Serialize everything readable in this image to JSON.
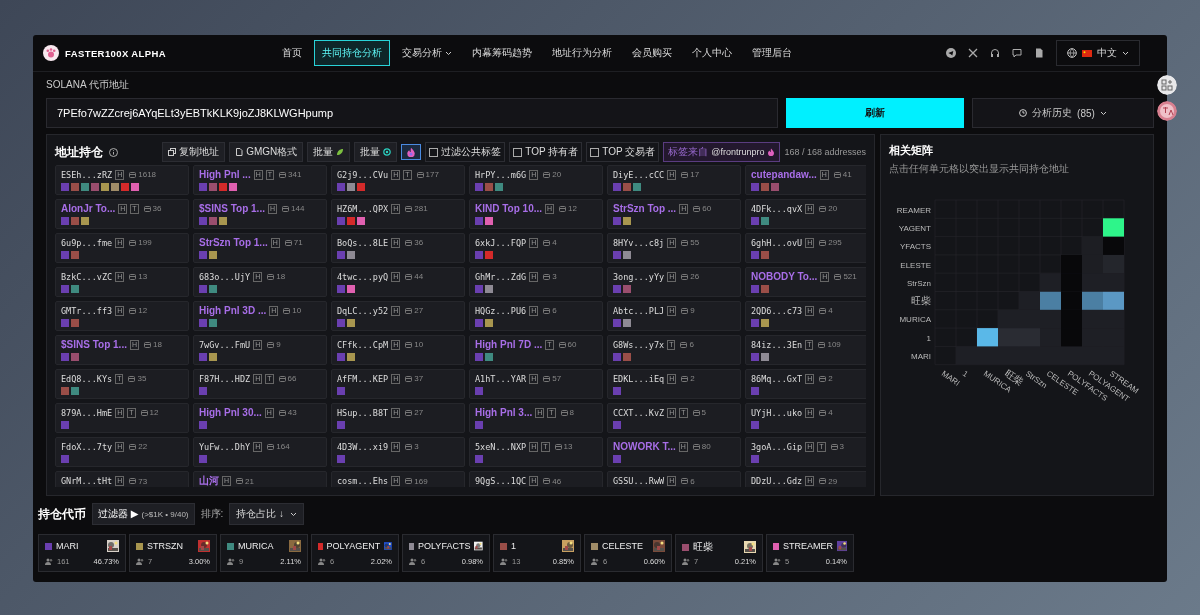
{
  "brand": "FASTER100X ALPHA",
  "nav": [
    {
      "label": "首页",
      "selected": false,
      "has_menu": false
    },
    {
      "label": "共同持仓分析",
      "selected": true,
      "has_menu": false
    },
    {
      "label": "交易分析",
      "selected": false,
      "has_menu": true
    },
    {
      "label": "内幕筹码趋势",
      "selected": false,
      "has_menu": false
    },
    {
      "label": "地址行为分析",
      "selected": false,
      "has_menu": false
    },
    {
      "label": "会员购买",
      "selected": false,
      "has_menu": false
    },
    {
      "label": "个人中心",
      "selected": false,
      "has_menu": false
    },
    {
      "label": "管理后台",
      "selected": false,
      "has_menu": false
    }
  ],
  "language": "中文",
  "token_address": {
    "label": "SOLANA 代币地址",
    "value": "7PEfo7wZZcrej6AYqELt3yEBTkKLK9joZJ8KLWGHpump"
  },
  "refresh_button": "刷新",
  "history": {
    "label": "分析历史",
    "count": "(85)"
  },
  "holdings": {
    "title": "地址持仓",
    "tools": [
      "复制地址",
      "GMGN格式",
      "批量",
      "批量"
    ],
    "icon_toggle": {
      "on": true
    },
    "filters": [
      {
        "label": "过滤公共标签",
        "checked": false
      },
      {
        "label": "TOP 持有者",
        "checked": false
      },
      {
        "label": "TOP 交易者",
        "checked": false
      }
    ],
    "source_badge": {
      "prefix": "标签来自",
      "handle": "@frontrunpro"
    },
    "total": "168 / 168 addresses",
    "cards": [
      {
        "kind": "address",
        "name": "ESEh...zRZ",
        "tags": [
          "H"
        ],
        "count": "1618",
        "chips": [
          {
            "color": "#6a3fb0"
          },
          {
            "color": "#9a4e48"
          },
          {
            "color": "#3f8a80"
          },
          {
            "color": "#9a4e6e"
          },
          {
            "color": "#a8964f"
          },
          {
            "color": "#a08c68"
          },
          {
            "color": "#d42a2a"
          },
          {
            "color": "#e060b0"
          }
        ]
      },
      {
        "kind": "label",
        "name": "High Pnl ...",
        "tags": [
          "H",
          "T"
        ],
        "count": "341",
        "chips": [
          {
            "color": "#6a3fb0"
          },
          {
            "color": "#9a4e6e"
          },
          {
            "color": "#d42a2a"
          },
          {
            "color": "#e060b0"
          }
        ]
      },
      {
        "kind": "address",
        "name": "G2j9...CVu",
        "tags": [
          "H",
          "T"
        ],
        "count": "177",
        "chips": [
          {
            "color": "#6a3fb0"
          },
          {
            "color": "#8e8a94"
          },
          {
            "color": "#d42a2a"
          }
        ]
      },
      {
        "kind": "address",
        "name": "HrPY...m6G",
        "tags": [
          "H"
        ],
        "count": "20",
        "chips": [
          {
            "color": "#6a3fb0"
          },
          {
            "color": "#9a4e48"
          },
          {
            "color": "#3f8a80"
          }
        ]
      },
      {
        "kind": "address",
        "name": "DiyE...cCC",
        "tags": [
          "H"
        ],
        "count": "17",
        "chips": [
          {
            "color": "#6a3fb0"
          },
          {
            "color": "#9a4e48"
          },
          {
            "color": "#3f8a80"
          }
        ]
      },
      {
        "kind": "label",
        "name": "cutepandaw...",
        "tags": [
          "H"
        ],
        "count": "41",
        "chips": [
          {
            "color": "#6a3fb0"
          },
          {
            "color": "#9a4e48"
          },
          {
            "color": "#9a4e6e"
          }
        ]
      },
      {
        "kind": "label",
        "name": "AlonJr To...",
        "tags": [
          "H",
          "T"
        ],
        "count": "36",
        "chips": [
          {
            "color": "#6a3fb0"
          },
          {
            "color": "#9a4e48"
          },
          {
            "color": "#a8964f"
          }
        ]
      },
      {
        "kind": "label",
        "name": "$SINS Top 1...",
        "tags": [
          "H"
        ],
        "count": "144",
        "chips": [
          {
            "color": "#6a3fb0"
          },
          {
            "color": "#9a4e6e"
          },
          {
            "color": "#a8964f"
          }
        ]
      },
      {
        "kind": "address",
        "name": "HZ6M...QPX",
        "tags": [
          "H"
        ],
        "count": "281",
        "chips": [
          {
            "color": "#6a3fb0"
          },
          {
            "color": "#d42a2a"
          },
          {
            "color": "#e060b0"
          }
        ]
      },
      {
        "kind": "label",
        "name": "KIND Top 10...",
        "tags": [
          "H"
        ],
        "count": "12",
        "chips": [
          {
            "color": "#6a3fb0"
          },
          {
            "color": "#e060b0"
          }
        ]
      },
      {
        "kind": "label",
        "name": "StrSzn Top ...",
        "tags": [
          "H"
        ],
        "count": "60",
        "chips": [
          {
            "color": "#6a3fb0"
          },
          {
            "color": "#a8964f"
          }
        ]
      },
      {
        "kind": "address",
        "name": "4DFk...qvX",
        "tags": [
          "H"
        ],
        "count": "20",
        "chips": [
          {
            "color": "#6a3fb0"
          },
          {
            "color": "#3f8a80"
          }
        ]
      },
      {
        "kind": "address",
        "name": "6u9p...fme",
        "tags": [
          "H"
        ],
        "count": "199",
        "chips": [
          {
            "color": "#6a3fb0"
          },
          {
            "color": "#9a4e48"
          }
        ]
      },
      {
        "kind": "label",
        "name": "StrSzn Top 1...",
        "tags": [
          "H"
        ],
        "count": "71",
        "chips": [
          {
            "color": "#6a3fb0"
          },
          {
            "color": "#a8964f"
          }
        ]
      },
      {
        "kind": "address",
        "name": "BoQs...8LE",
        "tags": [
          "H"
        ],
        "count": "36",
        "chips": [
          {
            "color": "#6a3fb0"
          },
          {
            "color": "#8e8a94"
          }
        ]
      },
      {
        "kind": "address",
        "name": "6xkJ...FQP",
        "tags": [
          "H"
        ],
        "count": "4",
        "chips": [
          {
            "color": "#6a3fb0"
          },
          {
            "color": "#d42a2a"
          }
        ]
      },
      {
        "kind": "address",
        "name": "8HYv...c8j",
        "tags": [
          "H"
        ],
        "count": "55",
        "chips": [
          {
            "color": "#6a3fb0"
          },
          {
            "color": "#8e8a94"
          }
        ]
      },
      {
        "kind": "address",
        "name": "6ghH...ovU",
        "tags": [
          "H"
        ],
        "count": "295",
        "chips": [
          {
            "color": "#6a3fb0"
          },
          {
            "color": "#9a4e48"
          }
        ]
      },
      {
        "kind": "address",
        "name": "BzkC...vZC",
        "tags": [
          "H"
        ],
        "count": "13",
        "chips": [
          {
            "color": "#6a3fb0"
          },
          {
            "color": "#3f8a80"
          }
        ]
      },
      {
        "kind": "address",
        "name": "683o...UjY",
        "tags": [
          "H"
        ],
        "count": "18",
        "chips": [
          {
            "color": "#6a3fb0"
          },
          {
            "color": "#3f8a80"
          }
        ]
      },
      {
        "kind": "address",
        "name": "4twc...pyQ",
        "tags": [
          "H"
        ],
        "count": "44",
        "chips": [
          {
            "color": "#6a3fb0"
          },
          {
            "color": "#e060b0"
          }
        ]
      },
      {
        "kind": "address",
        "name": "GhMr...ZdG",
        "tags": [
          "H"
        ],
        "count": "3",
        "chips": [
          {
            "color": "#6a3fb0"
          },
          {
            "color": "#8e8a94"
          }
        ]
      },
      {
        "kind": "address",
        "name": "3ong...yYy",
        "tags": [
          "H"
        ],
        "count": "26",
        "chips": [
          {
            "color": "#6a3fb0"
          },
          {
            "color": "#9a4e6e"
          }
        ]
      },
      {
        "kind": "label",
        "name": "NOBODY To...",
        "tags": [
          "H"
        ],
        "count": "521",
        "chips": [
          {
            "color": "#6a3fb0"
          },
          {
            "color": "#9a4e48"
          }
        ]
      },
      {
        "kind": "address",
        "name": "GMTr...ff3",
        "tags": [
          "H"
        ],
        "count": "12",
        "chips": [
          {
            "color": "#6a3fb0"
          },
          {
            "color": "#9a4e48"
          }
        ]
      },
      {
        "kind": "label",
        "name": "High Pnl 3D ...",
        "tags": [
          "H"
        ],
        "count": "10",
        "chips": [
          {
            "color": "#6a3fb0"
          },
          {
            "color": "#3f8a80"
          }
        ]
      },
      {
        "kind": "address",
        "name": "DqLC...y52",
        "tags": [
          "H"
        ],
        "count": "27",
        "chips": [
          {
            "color": "#6a3fb0"
          },
          {
            "color": "#a8964f"
          }
        ]
      },
      {
        "kind": "address",
        "name": "HQGz...PU6",
        "tags": [
          "H"
        ],
        "count": "6",
        "chips": [
          {
            "color": "#6a3fb0"
          },
          {
            "color": "#a8964f"
          }
        ]
      },
      {
        "kind": "address",
        "name": "Abtc...PLJ",
        "tags": [
          "H"
        ],
        "count": "9",
        "chips": [
          {
            "color": "#6a3fb0"
          },
          {
            "color": "#8e8a94"
          }
        ]
      },
      {
        "kind": "address",
        "name": "2QD6...c73",
        "tags": [
          "H"
        ],
        "count": "4",
        "chips": [
          {
            "color": "#6a3fb0"
          },
          {
            "color": "#a8964f"
          }
        ]
      },
      {
        "kind": "label",
        "name": "$SINS Top 1...",
        "tags": [
          "H"
        ],
        "count": "18",
        "chips": [
          {
            "color": "#6a3fb0"
          },
          {
            "color": "#9a4e6e"
          }
        ]
      },
      {
        "kind": "address",
        "name": "7wGv...FmU",
        "tags": [
          "H"
        ],
        "count": "9",
        "chips": [
          {
            "color": "#6a3fb0"
          },
          {
            "color": "#a8964f"
          }
        ]
      },
      {
        "kind": "address",
        "name": "CFfk...CpM",
        "tags": [
          "H"
        ],
        "count": "10",
        "chips": [
          {
            "color": "#6a3fb0"
          },
          {
            "color": "#a8964f"
          }
        ]
      },
      {
        "kind": "label",
        "name": "High Pnl 7D ...",
        "tags": [
          "T"
        ],
        "count": "60",
        "chips": [
          {
            "color": "#6a3fb0"
          },
          {
            "color": "#3f8a80"
          }
        ]
      },
      {
        "kind": "address",
        "name": "G8Ws...y7x",
        "tags": [
          "T"
        ],
        "count": "6",
        "chips": [
          {
            "color": "#6a3fb0"
          },
          {
            "color": "#9a4e48"
          }
        ]
      },
      {
        "kind": "address",
        "name": "84iz...3En",
        "tags": [
          "T"
        ],
        "count": "109",
        "chips": [
          {
            "color": "#6a3fb0"
          },
          {
            "color": "#8e8a94"
          }
        ]
      },
      {
        "kind": "address",
        "name": "EdQ8...KYs",
        "tags": [
          "T"
        ],
        "count": "35",
        "chips": [
          {
            "color": "#9a4e48"
          },
          {
            "color": "#3f8a80"
          }
        ]
      },
      {
        "kind": "address",
        "name": "F87H...HDZ",
        "tags": [
          "H",
          "T"
        ],
        "count": "66",
        "chips": [
          {
            "color": "#6a3fb0"
          }
        ]
      },
      {
        "kind": "address",
        "name": "AfFM...KEP",
        "tags": [
          "H"
        ],
        "count": "37",
        "chips": [
          {
            "color": "#6a3fb0"
          }
        ]
      },
      {
        "kind": "address",
        "name": "A1hT...YAR",
        "tags": [
          "H"
        ],
        "count": "57",
        "chips": [
          {
            "color": "#6a3fb0"
          }
        ]
      },
      {
        "kind": "address",
        "name": "EDKL...iEq",
        "tags": [
          "H"
        ],
        "count": "2",
        "chips": [
          {
            "color": "#6a3fb0"
          }
        ]
      },
      {
        "kind": "address",
        "name": "86Mq...GxT",
        "tags": [
          "H"
        ],
        "count": "2",
        "chips": [
          {
            "color": "#6a3fb0"
          }
        ]
      },
      {
        "kind": "address",
        "name": "879A...HmE",
        "tags": [
          "H",
          "T"
        ],
        "count": "12",
        "chips": [
          {
            "color": "#6a3fb0"
          }
        ]
      },
      {
        "kind": "label",
        "name": "High Pnl 30...",
        "tags": [
          "H"
        ],
        "count": "43",
        "chips": [
          {
            "color": "#6a3fb0"
          }
        ]
      },
      {
        "kind": "address",
        "name": "HSup...B8T",
        "tags": [
          "H"
        ],
        "count": "27",
        "chips": [
          {
            "color": "#6a3fb0"
          }
        ]
      },
      {
        "kind": "label",
        "name": "High Pnl 3...",
        "tags": [
          "H",
          "T"
        ],
        "count": "8",
        "chips": [
          {
            "color": "#6a3fb0"
          }
        ]
      },
      {
        "kind": "address",
        "name": "CCXT...KvZ",
        "tags": [
          "H",
          "T"
        ],
        "count": "5",
        "chips": [
          {
            "color": "#6a3fb0"
          }
        ]
      },
      {
        "kind": "address",
        "name": "UYjH...uko",
        "tags": [
          "H"
        ],
        "count": "4",
        "chips": [
          {
            "color": "#6a3fb0"
          }
        ]
      },
      {
        "kind": "address",
        "name": "FdoX...7ty",
        "tags": [
          "H"
        ],
        "count": "22",
        "chips": [
          {
            "color": "#6a3fb0"
          }
        ]
      },
      {
        "kind": "address",
        "name": "YuFw...DhY",
        "tags": [
          "H"
        ],
        "count": "164",
        "chips": [
          {
            "color": "#6a3fb0"
          }
        ]
      },
      {
        "kind": "address",
        "name": "4D3W...xi9",
        "tags": [
          "H"
        ],
        "count": "3",
        "chips": [
          {
            "color": "#6a3fb0"
          }
        ]
      },
      {
        "kind": "address",
        "name": "5xeN...NXP",
        "tags": [
          "H",
          "T"
        ],
        "count": "13",
        "chips": [
          {
            "color": "#6a3fb0"
          }
        ]
      },
      {
        "kind": "label",
        "name": "NOWORK T...",
        "tags": [
          "H"
        ],
        "count": "80",
        "chips": [
          {
            "color": "#6a3fb0"
          }
        ]
      },
      {
        "kind": "address",
        "name": "3goA...Gip",
        "tags": [
          "H",
          "T"
        ],
        "count": "3",
        "chips": [
          {
            "color": "#6a3fb0"
          }
        ]
      },
      {
        "kind": "address",
        "name": "GNrM...tHt",
        "tags": [
          "H"
        ],
        "count": "73"
      },
      {
        "kind": "label",
        "name": "山河",
        "tags": [
          "H"
        ],
        "count": "21"
      },
      {
        "kind": "address",
        "name": "cosm...Ehs",
        "tags": [
          "H"
        ],
        "count": "169"
      },
      {
        "kind": "address",
        "name": "9QgS...1QC",
        "tags": [
          "H"
        ],
        "count": "46"
      },
      {
        "kind": "address",
        "name": "GSSU...RwW",
        "tags": [
          "H"
        ],
        "count": "6"
      },
      {
        "kind": "address",
        "name": "DDzU...Gdz",
        "tags": [
          "H"
        ],
        "count": "29"
      }
    ]
  },
  "matrix": {
    "title": "相关矩阵",
    "subtitle": "点击任何单元格以突出显示共同持仓地址",
    "y_labels": [
      "REAMER",
      "YAGENT",
      "YFACTS",
      "ELESTE",
      "StrSzn",
      "旺柴",
      "MURICA",
      "1",
      "MARI"
    ],
    "x_labels": [
      "MARI",
      "1",
      "MURICA",
      "旺柴",
      "StrSzn",
      "CELESTE",
      "POLYFACTS",
      "POLYAGENT",
      "STREAM"
    ]
  },
  "tokens_bar": {
    "title": "持仓代币",
    "filter": "过滤器 ▶",
    "filter_note": "(>$1K • 9/40)",
    "sort_label": "排序:",
    "sort_value": "持仓占比 ↓",
    "tokens": [
      {
        "name": "MARI",
        "color": "#6a3fb0",
        "holders": "161",
        "share": "46.73%"
      },
      {
        "name": "STRSZN",
        "color": "#a8964f",
        "holders": "7",
        "share": "3.00%"
      },
      {
        "name": "MURICA",
        "color": "#3f8a80",
        "holders": "9",
        "share": "2.11%"
      },
      {
        "name": "POLYAGENT",
        "color": "#d42a2a",
        "holders": "6",
        "share": "2.02%"
      },
      {
        "name": "POLYFACTS",
        "color": "#8e8a94",
        "holders": "6",
        "share": "0.98%"
      },
      {
        "name": "1",
        "color": "#9a4e48",
        "holders": "13",
        "share": "0.85%"
      },
      {
        "name": "CELESTE",
        "color": "#a08c68",
        "holders": "6",
        "share": "0.60%"
      },
      {
        "name": "旺柴",
        "color": "#9a4e6e",
        "holders": "7",
        "share": "0.21%"
      },
      {
        "name": "STREAMER",
        "color": "#e060b0",
        "holders": "5",
        "share": "0.14%"
      }
    ]
  }
}
